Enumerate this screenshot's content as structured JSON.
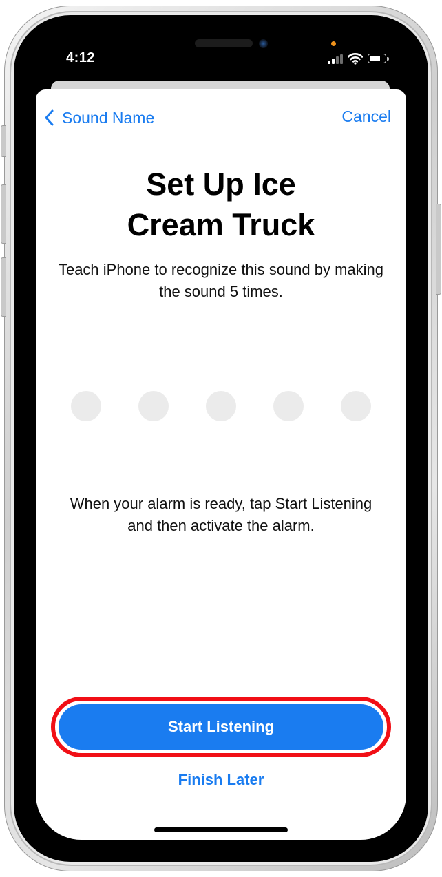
{
  "status_bar": {
    "time": "4:12",
    "icons": [
      "cellular-signal-icon",
      "wifi-icon",
      "battery-icon"
    ]
  },
  "nav": {
    "back_label": "Sound Name",
    "back_icon": "chevron-left-icon",
    "cancel_label": "Cancel"
  },
  "header": {
    "title_line1": "Set Up Ice",
    "title_line2": "Cream Truck",
    "subtitle": "Teach iPhone to recognize this sound by making the sound 5 times."
  },
  "progress": {
    "total_samples": 5,
    "recorded_samples": 0
  },
  "instruction": "When your alarm is ready, tap Start Listening and then activate the alarm.",
  "actions": {
    "primary_label": "Start Listening",
    "secondary_label": "Finish Later"
  },
  "colors": {
    "accent": "#1a7cf0",
    "highlight": "#f10f16",
    "dot_inactive": "#ebebeb"
  }
}
